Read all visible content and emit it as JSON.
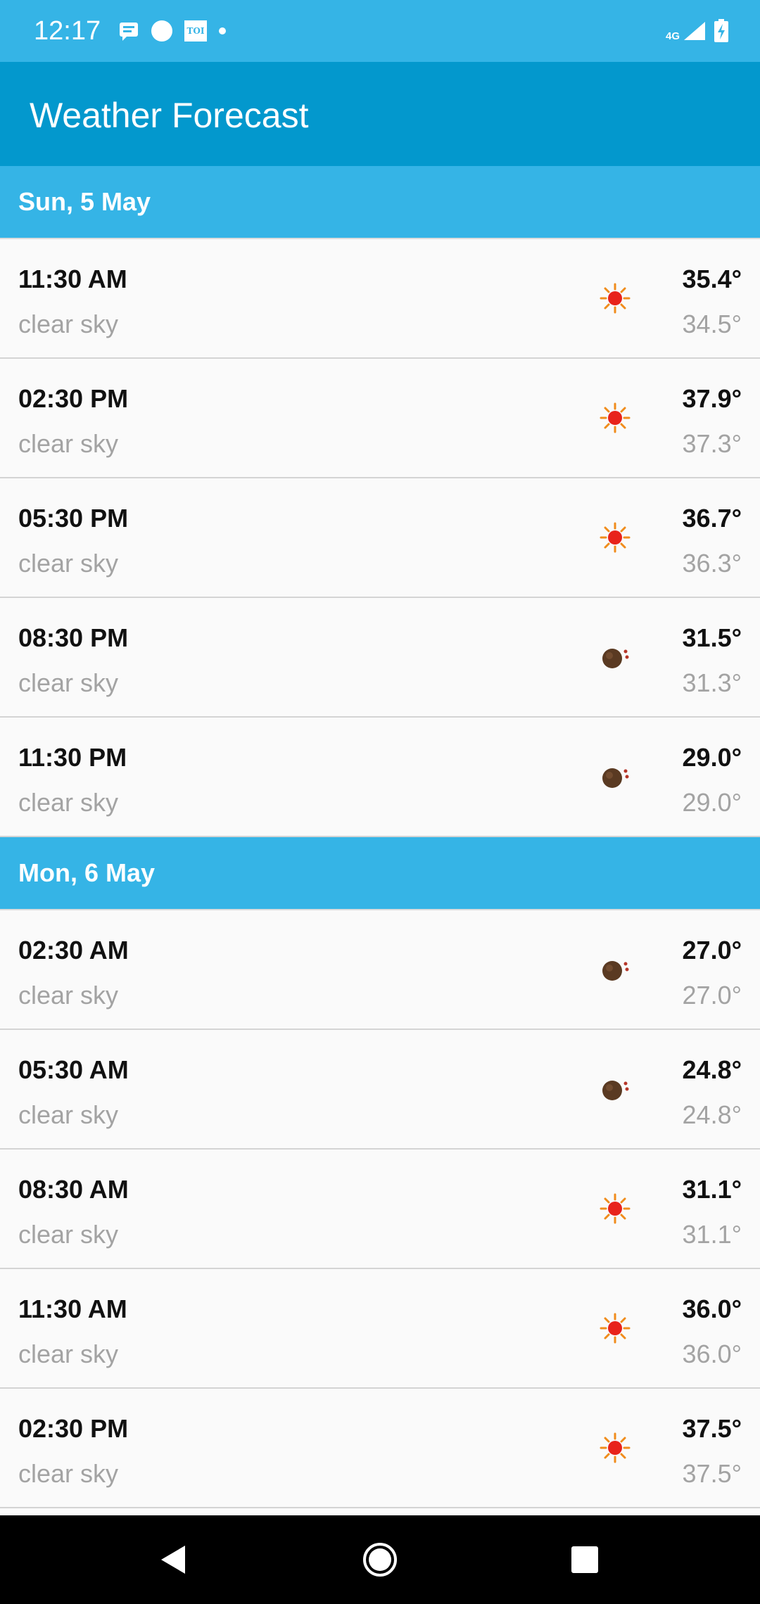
{
  "status_bar": {
    "time": "12:17",
    "left_icons": [
      "message-icon",
      "circle-notification-icon",
      "toi-app-icon",
      "dot-icon"
    ],
    "toi_label": "TOI",
    "network_label": "4G",
    "right_icons": [
      "signal-icon",
      "battery-charging-icon"
    ]
  },
  "app_bar": {
    "title": "Weather Forecast",
    "color": "#0398cd"
  },
  "colors": {
    "status_bar": "#35b4e6",
    "section_header": "#35b4e6",
    "primary_text": "#111111",
    "secondary_text": "#a3a3a3"
  },
  "sections": [
    {
      "date": "Sun, 5 May",
      "rows": [
        {
          "time": "11:30 AM",
          "desc": "clear sky",
          "icon": "sun-icon",
          "temp_max": "35.4°",
          "temp_min": "34.5°"
        },
        {
          "time": "02:30 PM",
          "desc": "clear sky",
          "icon": "sun-icon",
          "temp_max": "37.9°",
          "temp_min": "37.3°"
        },
        {
          "time": "05:30 PM",
          "desc": "clear sky",
          "icon": "sun-icon",
          "temp_max": "36.7°",
          "temp_min": "36.3°"
        },
        {
          "time": "08:30 PM",
          "desc": "clear sky",
          "icon": "moon-icon",
          "temp_max": "31.5°",
          "temp_min": "31.3°"
        },
        {
          "time": "11:30 PM",
          "desc": "clear sky",
          "icon": "moon-icon",
          "temp_max": "29.0°",
          "temp_min": "29.0°"
        }
      ]
    },
    {
      "date": "Mon, 6 May",
      "rows": [
        {
          "time": "02:30 AM",
          "desc": "clear sky",
          "icon": "moon-icon",
          "temp_max": "27.0°",
          "temp_min": "27.0°"
        },
        {
          "time": "05:30 AM",
          "desc": "clear sky",
          "icon": "moon-icon",
          "temp_max": "24.8°",
          "temp_min": "24.8°"
        },
        {
          "time": "08:30 AM",
          "desc": "clear sky",
          "icon": "sun-icon",
          "temp_max": "31.1°",
          "temp_min": "31.1°"
        },
        {
          "time": "11:30 AM",
          "desc": "clear sky",
          "icon": "sun-icon",
          "temp_max": "36.0°",
          "temp_min": "36.0°"
        },
        {
          "time": "02:30 PM",
          "desc": "clear sky",
          "icon": "sun-icon",
          "temp_max": "37.5°",
          "temp_min": "37.5°"
        }
      ]
    }
  ],
  "nav_bar": {
    "buttons": [
      "back-icon",
      "home-icon",
      "recents-icon"
    ]
  }
}
